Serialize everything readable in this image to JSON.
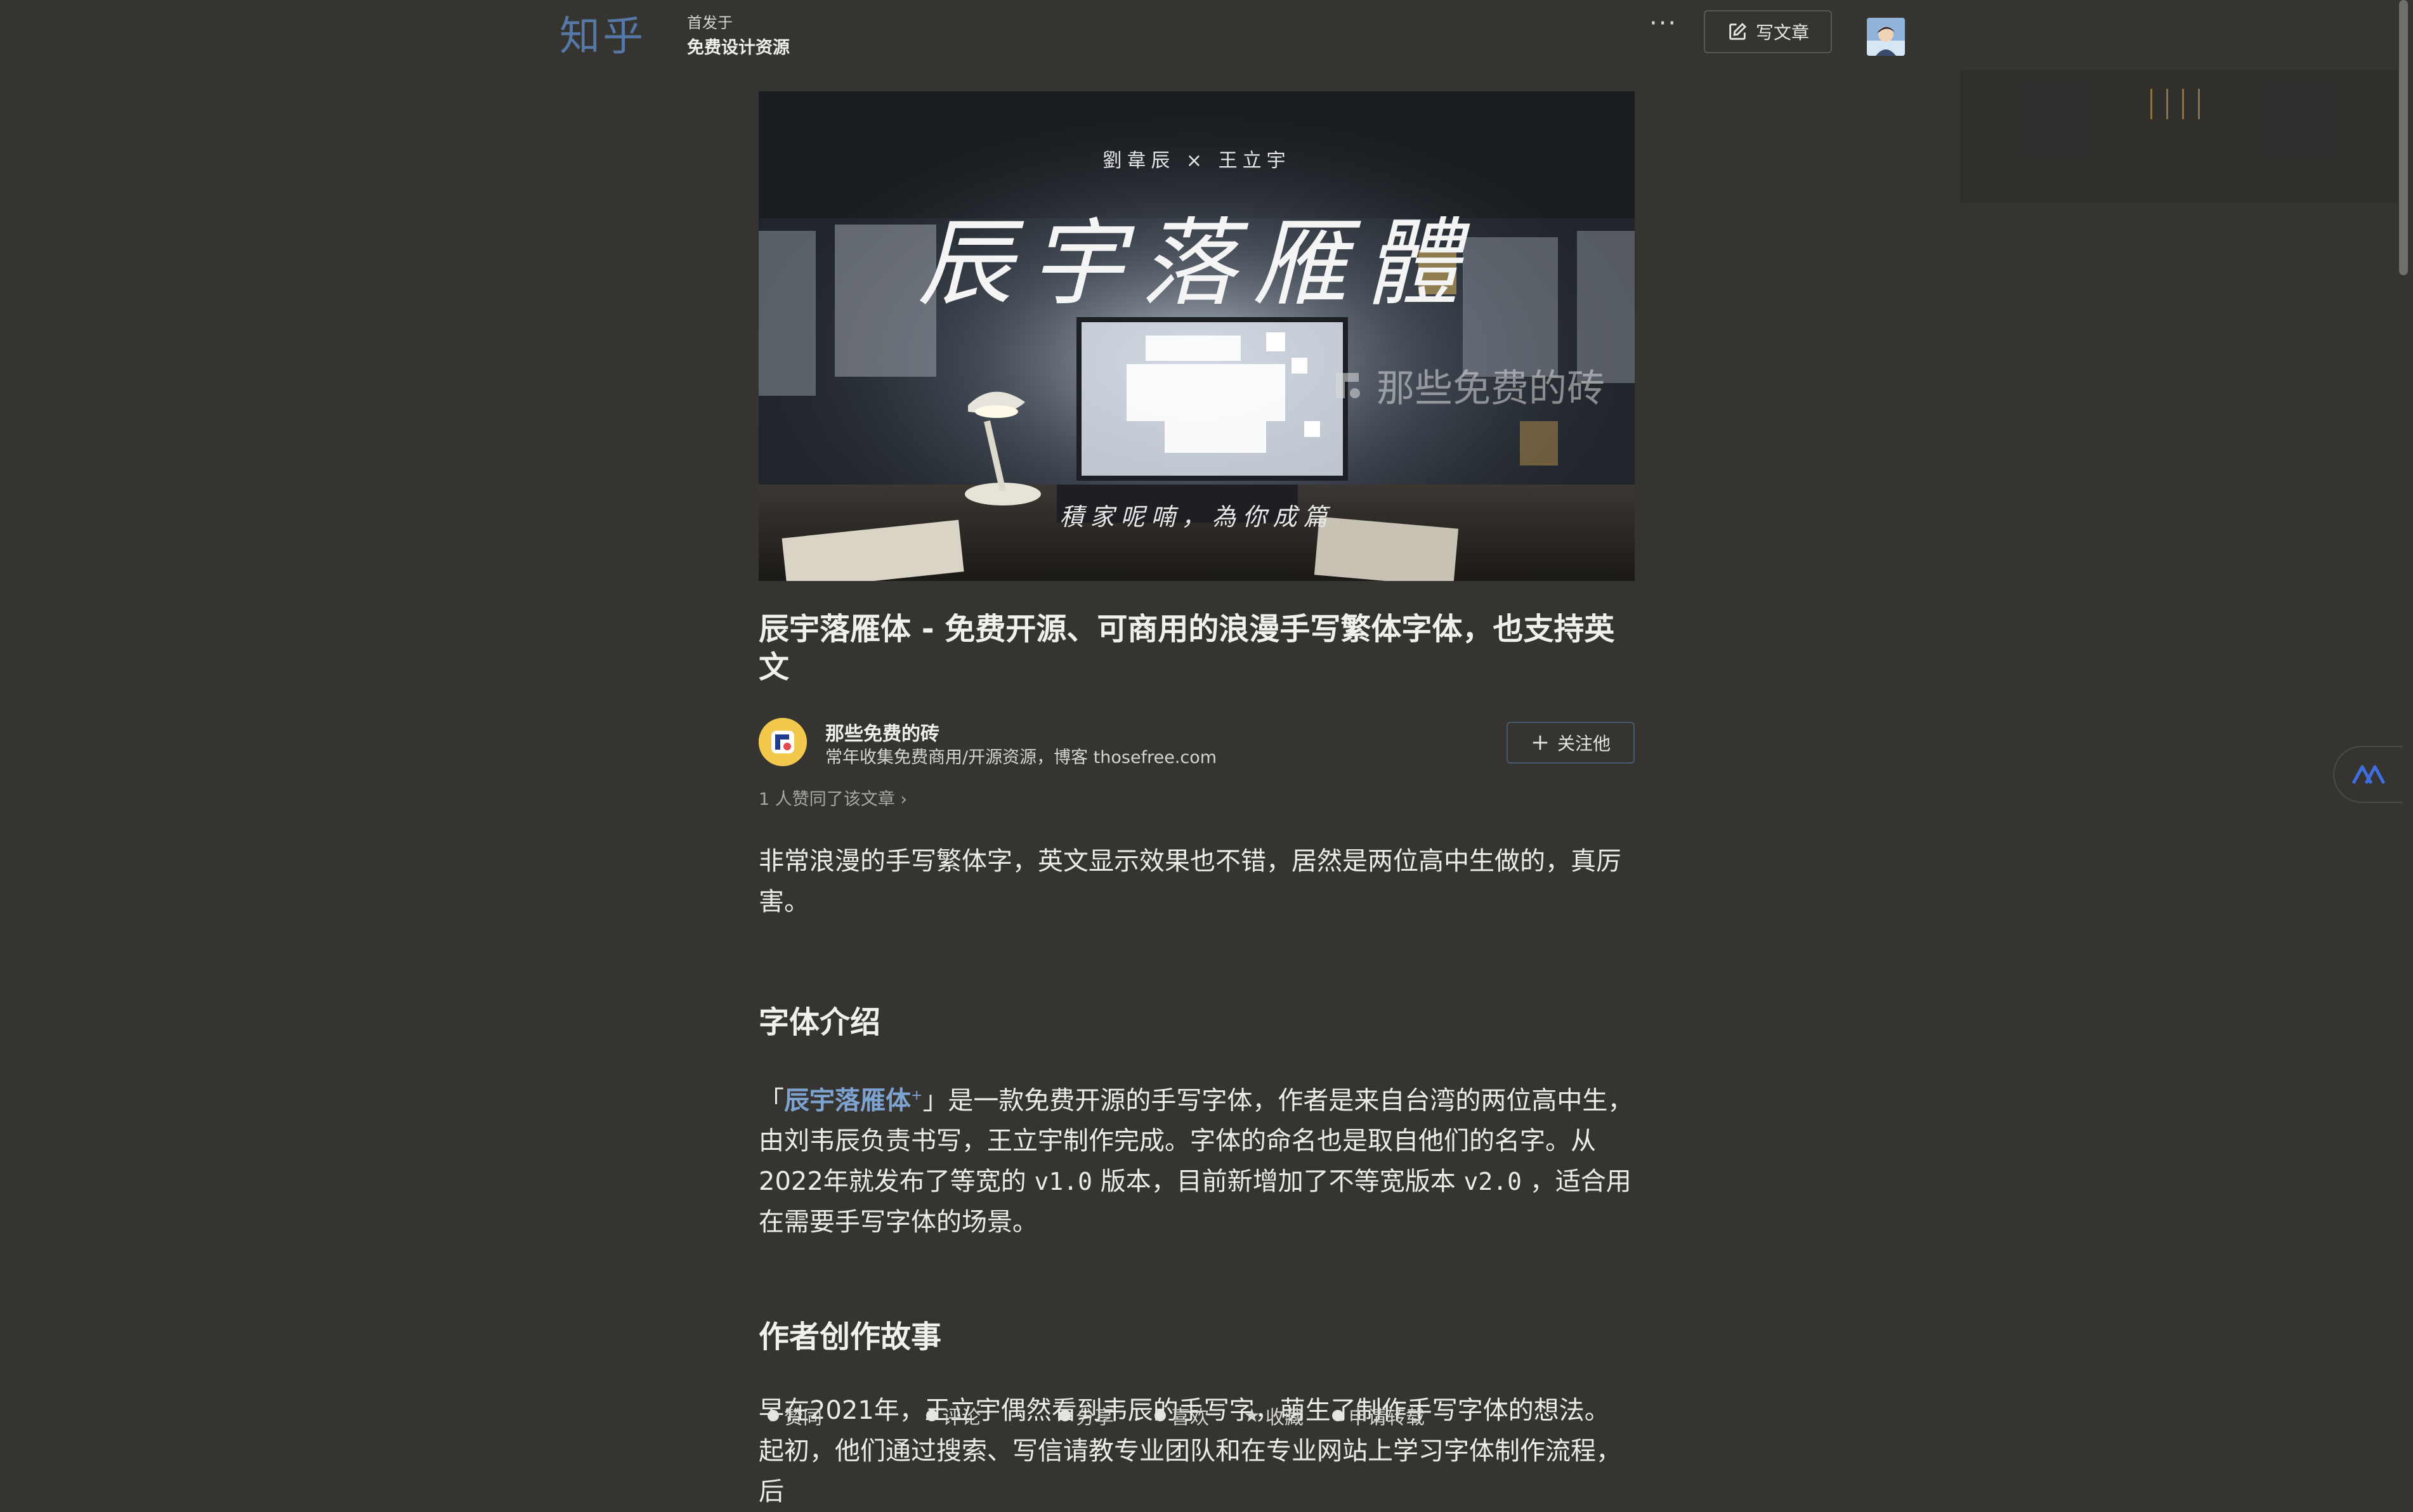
{
  "header": {
    "logo": "知乎",
    "published_label": "首发于",
    "column_name": "免费设计资源",
    "more": "···",
    "write_button": "写文章"
  },
  "hero": {
    "credit": "劉韋辰 × 王立宇",
    "title": "辰宇落雁體",
    "watermark": "那些免费的砖",
    "subtitle": "積家呢喃，為你成篇"
  },
  "article": {
    "title": "辰宇落雁体 - 免费开源、可商用的浪漫手写繁体字体，也支持英文",
    "author_name": "那些免费的砖",
    "author_bio": "常年收集免费商用/开源资源，博客 thosefree.com",
    "follow_button": "关注他",
    "likes": "1 人赞同了该文章 ›",
    "intro": "非常浪漫的手写繁体字，英文显示效果也不错，居然是两位高中生做的，真厉害。",
    "section1_title": "字体介绍",
    "p1_open": "「",
    "p1_link": "辰宇落雁体",
    "p1_sup": "+",
    "p1_a": "」是一款免费开源的手写字体，作者是来自台湾的两位高中生，由刘韦辰负责书写，王立宇制作完成。字体的命名也是取自他们的名字。从 2022年就发布了等宽的 ",
    "p1_code1": "v1.0",
    "p1_b": " 版本，目前新增加了不等宽版本 ",
    "p1_code2": "v2.0",
    "p1_c": " ，适合用在需要手写字体的场景。",
    "section2_title": "作者创作故事",
    "p2": "早在2021年，王立宇偶然看到韦辰的手写字，萌生了制作手写字体的想法。起初，他们通过搜索、写信请教专业团队和在专业网站上学习字体制作流程，后"
  },
  "bottom_bar": {
    "items": [
      "赞同",
      "评论",
      "分享",
      "喜欢",
      "收藏",
      "申请转载"
    ]
  }
}
